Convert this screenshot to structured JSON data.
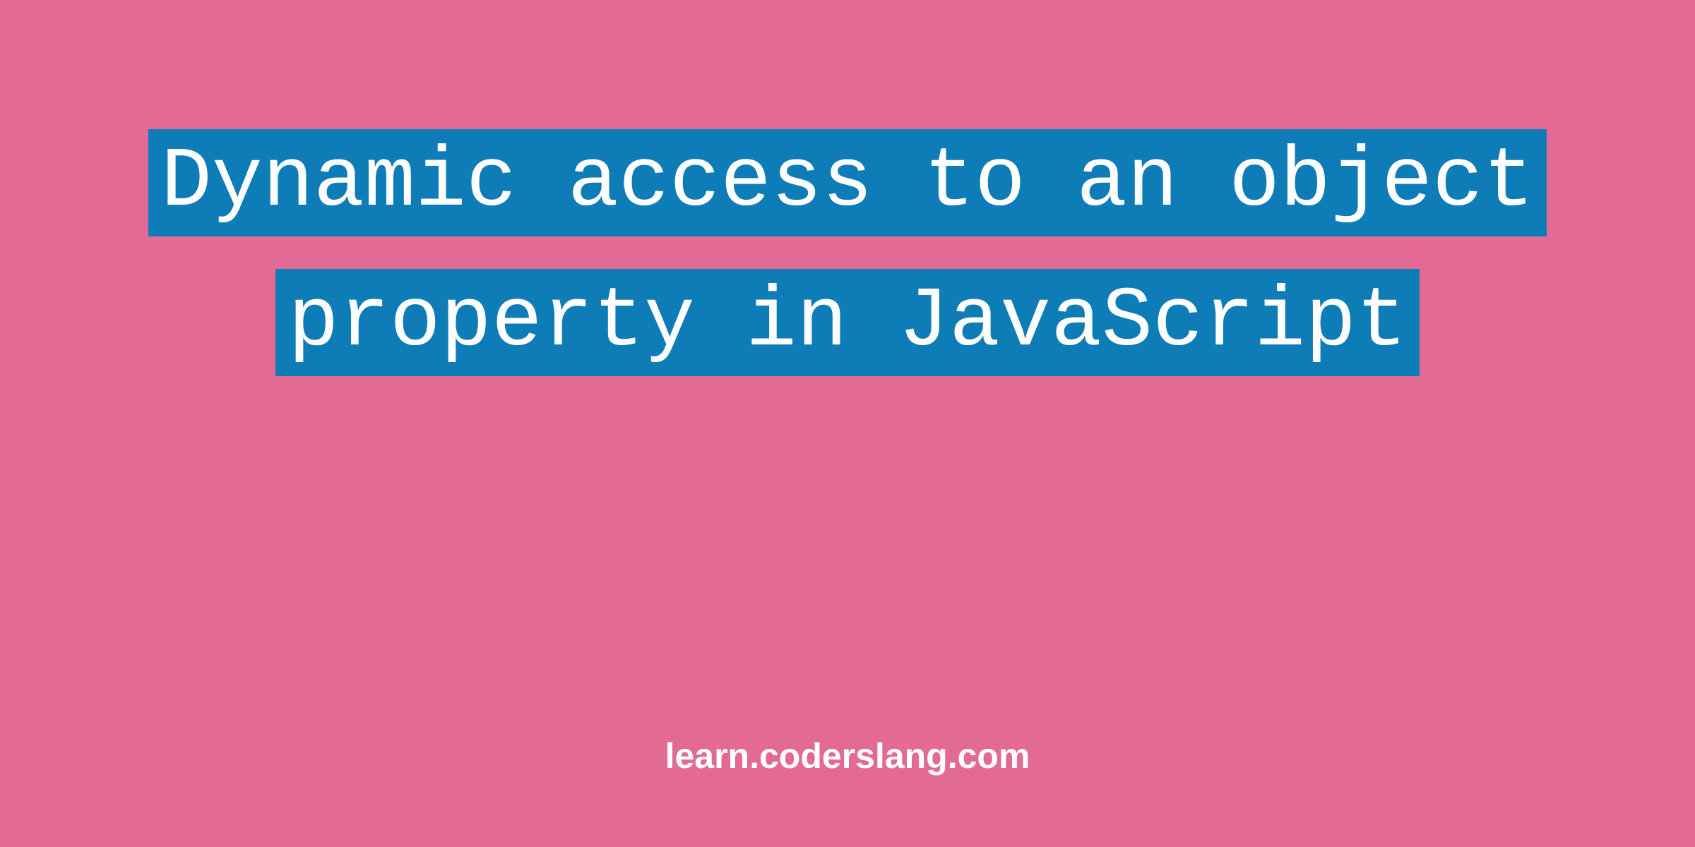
{
  "title": {
    "text": "Dynamic access to an object property in JavaScript"
  },
  "footer": {
    "text": "learn.coderslang.com"
  },
  "colors": {
    "background": "#e26a95",
    "highlight": "#0e7db7",
    "text": "#ffffff"
  }
}
